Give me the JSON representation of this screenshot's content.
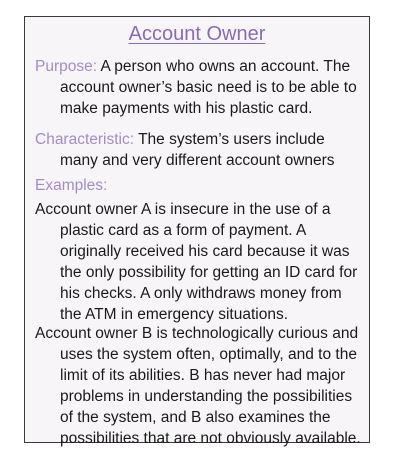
{
  "title": "Account Owner",
  "purpose": {
    "label": "Purpose:",
    "text": " A  person who owns an account. The account owner’s basic need is to be able to make payments with his plastic card."
  },
  "characteristic": {
    "label": "Characteristic:",
    "text": " The system’s users include many and very different account owners"
  },
  "examples_label": "Examples:",
  "examples": [
    "Account owner A is insecure in the use of a plastic card as a form of payment. A originally received his card because it was the only possibility for getting an ID card for his checks. A only withdraws money from the ATM in emergency situations.",
    "Account owner B is technologically curious and uses the system often, optimally, and to the limit of its abilities. B has never had major problems in understanding the possibilities of the system, and B also examines the possibilities that are not obviously available."
  ]
}
